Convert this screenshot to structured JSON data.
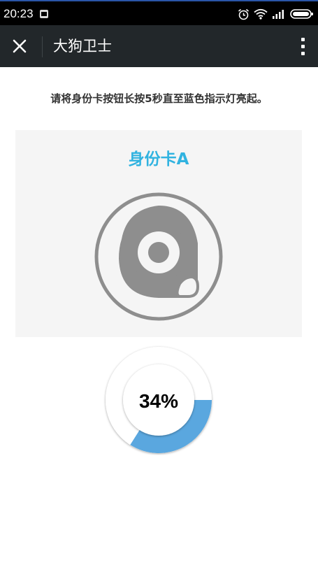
{
  "status_bar": {
    "time": "20:23"
  },
  "app_bar": {
    "title": "大狗卫士"
  },
  "instruction": "请将身份卡按钮长按5秒直至蓝色指示灯亮起。",
  "card": {
    "title": "身份卡A"
  },
  "progress": {
    "percent_text": "34%",
    "value": 0.34,
    "fill_color": "#5aa7df",
    "track_color": "#ffffff"
  },
  "colors": {
    "app_bar_bg": "#22272a",
    "card_title": "#31b3e0",
    "panel_bg": "#f5f5f5"
  }
}
